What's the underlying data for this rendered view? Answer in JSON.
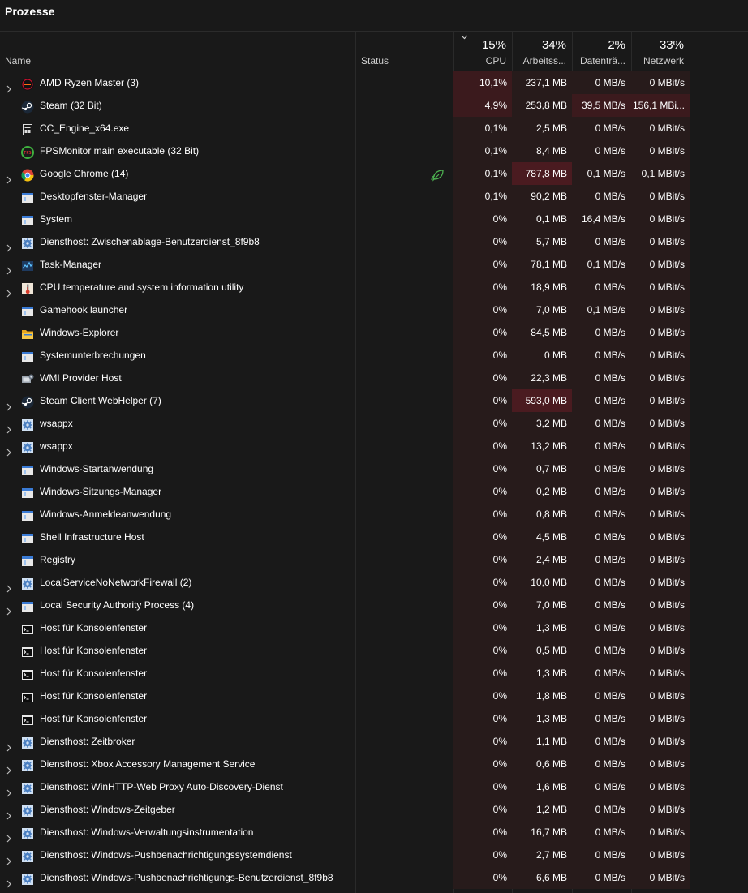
{
  "page": {
    "title": "Prozesse"
  },
  "columns": {
    "name": {
      "label": "Name"
    },
    "status": {
      "label": "Status"
    },
    "cpu": {
      "label": "CPU",
      "total": "15%"
    },
    "memory": {
      "label": "Arbeitss...",
      "total": "34%"
    },
    "disk": {
      "label": "Datenträ...",
      "total": "2%"
    },
    "network": {
      "label": "Netzwerk",
      "total": "33%"
    }
  },
  "colors": {
    "background": "#191919",
    "heat_low": "#271b1b",
    "heat_mid": "#3b1a1d",
    "heat_high": "#4a1b20",
    "eco_leaf": "#4caf50"
  },
  "processes": [
    {
      "name": "AMD Ryzen Master (3)",
      "icon": "amd-ryzen-icon",
      "expandable": true,
      "eco": false,
      "cpu": "10,1%",
      "mem": "237,1 MB",
      "disk": "0 MB/s",
      "net": "0 MBit/s",
      "heat": [
        2,
        1,
        1,
        1
      ]
    },
    {
      "name": "Steam (32 Bit)",
      "icon": "steam-icon",
      "expandable": false,
      "eco": false,
      "cpu": "4,9%",
      "mem": "253,8 MB",
      "disk": "39,5 MB/s",
      "net": "156,1 MBi...",
      "heat": [
        2,
        1,
        2,
        2
      ]
    },
    {
      "name": "CC_Engine_x64.exe",
      "icon": "app-generic-icon",
      "expandable": false,
      "eco": false,
      "cpu": "0,1%",
      "mem": "2,5 MB",
      "disk": "0 MB/s",
      "net": "0 MBit/s",
      "heat": [
        1,
        1,
        1,
        1
      ]
    },
    {
      "name": "FPSMonitor main executable (32 Bit)",
      "icon": "fpsmonitor-icon",
      "expandable": false,
      "eco": false,
      "cpu": "0,1%",
      "mem": "8,4 MB",
      "disk": "0 MB/s",
      "net": "0 MBit/s",
      "heat": [
        1,
        1,
        1,
        1
      ]
    },
    {
      "name": "Google Chrome (14)",
      "icon": "chrome-icon",
      "expandable": true,
      "eco": true,
      "cpu": "0,1%",
      "mem": "787,8 MB",
      "disk": "0,1 MB/s",
      "net": "0,1 MBit/s",
      "heat": [
        1,
        3,
        1,
        1
      ]
    },
    {
      "name": "Desktopfenster-Manager",
      "icon": "window-icon",
      "expandable": false,
      "eco": false,
      "cpu": "0,1%",
      "mem": "90,2 MB",
      "disk": "0 MB/s",
      "net": "0 MBit/s",
      "heat": [
        1,
        1,
        1,
        1
      ]
    },
    {
      "name": "System",
      "icon": "window-icon",
      "expandable": false,
      "eco": false,
      "cpu": "0%",
      "mem": "0,1 MB",
      "disk": "16,4 MB/s",
      "net": "0 MBit/s",
      "heat": [
        1,
        1,
        1,
        1
      ]
    },
    {
      "name": "Diensthost: Zwischenablage-Benutzerdienst_8f9b8",
      "icon": "gear-icon",
      "expandable": true,
      "eco": false,
      "cpu": "0%",
      "mem": "5,7 MB",
      "disk": "0 MB/s",
      "net": "0 MBit/s",
      "heat": [
        1,
        1,
        1,
        1
      ]
    },
    {
      "name": "Task-Manager",
      "icon": "taskmanager-icon",
      "expandable": true,
      "eco": false,
      "cpu": "0%",
      "mem": "78,1 MB",
      "disk": "0,1 MB/s",
      "net": "0 MBit/s",
      "heat": [
        1,
        1,
        1,
        1
      ]
    },
    {
      "name": "CPU temperature and system information utility",
      "icon": "thermometer-icon",
      "expandable": true,
      "eco": false,
      "cpu": "0%",
      "mem": "18,9 MB",
      "disk": "0 MB/s",
      "net": "0 MBit/s",
      "heat": [
        1,
        1,
        1,
        1
      ]
    },
    {
      "name": "Gamehook launcher",
      "icon": "window-icon",
      "expandable": false,
      "eco": false,
      "cpu": "0%",
      "mem": "7,0 MB",
      "disk": "0,1 MB/s",
      "net": "0 MBit/s",
      "heat": [
        1,
        1,
        1,
        1
      ]
    },
    {
      "name": "Windows-Explorer",
      "icon": "folder-icon",
      "expandable": false,
      "eco": false,
      "cpu": "0%",
      "mem": "84,5 MB",
      "disk": "0 MB/s",
      "net": "0 MBit/s",
      "heat": [
        1,
        1,
        1,
        1
      ]
    },
    {
      "name": "Systemunterbrechungen",
      "icon": "window-icon",
      "expandable": false,
      "eco": false,
      "cpu": "0%",
      "mem": "0 MB",
      "disk": "0 MB/s",
      "net": "0 MBit/s",
      "heat": [
        1,
        1,
        1,
        1
      ]
    },
    {
      "name": "WMI Provider Host",
      "icon": "wmi-icon",
      "expandable": false,
      "eco": false,
      "cpu": "0%",
      "mem": "22,3 MB",
      "disk": "0 MB/s",
      "net": "0 MBit/s",
      "heat": [
        1,
        1,
        1,
        1
      ]
    },
    {
      "name": "Steam Client WebHelper (7)",
      "icon": "steam-icon",
      "expandable": true,
      "eco": false,
      "cpu": "0%",
      "mem": "593,0 MB",
      "disk": "0 MB/s",
      "net": "0 MBit/s",
      "heat": [
        1,
        3,
        1,
        1
      ]
    },
    {
      "name": "wsappx",
      "icon": "gear-icon",
      "expandable": true,
      "eco": false,
      "cpu": "0%",
      "mem": "3,2 MB",
      "disk": "0 MB/s",
      "net": "0 MBit/s",
      "heat": [
        1,
        1,
        1,
        1
      ]
    },
    {
      "name": "wsappx",
      "icon": "gear-icon",
      "expandable": true,
      "eco": false,
      "cpu": "0%",
      "mem": "13,2 MB",
      "disk": "0 MB/s",
      "net": "0 MBit/s",
      "heat": [
        1,
        1,
        1,
        1
      ]
    },
    {
      "name": "Windows-Startanwendung",
      "icon": "window-icon",
      "expandable": false,
      "eco": false,
      "cpu": "0%",
      "mem": "0,7 MB",
      "disk": "0 MB/s",
      "net": "0 MBit/s",
      "heat": [
        1,
        1,
        1,
        1
      ]
    },
    {
      "name": "Windows-Sitzungs-Manager",
      "icon": "window-icon",
      "expandable": false,
      "eco": false,
      "cpu": "0%",
      "mem": "0,2 MB",
      "disk": "0 MB/s",
      "net": "0 MBit/s",
      "heat": [
        1,
        1,
        1,
        1
      ]
    },
    {
      "name": "Windows-Anmeldeanwendung",
      "icon": "window-icon",
      "expandable": false,
      "eco": false,
      "cpu": "0%",
      "mem": "0,8 MB",
      "disk": "0 MB/s",
      "net": "0 MBit/s",
      "heat": [
        1,
        1,
        1,
        1
      ]
    },
    {
      "name": "Shell Infrastructure Host",
      "icon": "window-icon",
      "expandable": false,
      "eco": false,
      "cpu": "0%",
      "mem": "4,5 MB",
      "disk": "0 MB/s",
      "net": "0 MBit/s",
      "heat": [
        1,
        1,
        1,
        1
      ]
    },
    {
      "name": "Registry",
      "icon": "window-icon",
      "expandable": false,
      "eco": false,
      "cpu": "0%",
      "mem": "2,4 MB",
      "disk": "0 MB/s",
      "net": "0 MBit/s",
      "heat": [
        1,
        1,
        1,
        1
      ]
    },
    {
      "name": "LocalServiceNoNetworkFirewall (2)",
      "icon": "gear-icon",
      "expandable": true,
      "eco": false,
      "cpu": "0%",
      "mem": "10,0 MB",
      "disk": "0 MB/s",
      "net": "0 MBit/s",
      "heat": [
        1,
        1,
        1,
        1
      ]
    },
    {
      "name": "Local Security Authority Process (4)",
      "icon": "window-icon",
      "expandable": true,
      "eco": false,
      "cpu": "0%",
      "mem": "7,0 MB",
      "disk": "0 MB/s",
      "net": "0 MBit/s",
      "heat": [
        1,
        1,
        1,
        1
      ]
    },
    {
      "name": "Host für Konsolenfenster",
      "icon": "console-icon",
      "expandable": false,
      "eco": false,
      "cpu": "0%",
      "mem": "1,3 MB",
      "disk": "0 MB/s",
      "net": "0 MBit/s",
      "heat": [
        1,
        1,
        1,
        1
      ]
    },
    {
      "name": "Host für Konsolenfenster",
      "icon": "console-icon",
      "expandable": false,
      "eco": false,
      "cpu": "0%",
      "mem": "0,5 MB",
      "disk": "0 MB/s",
      "net": "0 MBit/s",
      "heat": [
        1,
        1,
        1,
        1
      ]
    },
    {
      "name": "Host für Konsolenfenster",
      "icon": "console-icon",
      "expandable": false,
      "eco": false,
      "cpu": "0%",
      "mem": "1,3 MB",
      "disk": "0 MB/s",
      "net": "0 MBit/s",
      "heat": [
        1,
        1,
        1,
        1
      ]
    },
    {
      "name": "Host für Konsolenfenster",
      "icon": "console-icon",
      "expandable": false,
      "eco": false,
      "cpu": "0%",
      "mem": "1,8 MB",
      "disk": "0 MB/s",
      "net": "0 MBit/s",
      "heat": [
        1,
        1,
        1,
        1
      ]
    },
    {
      "name": "Host für Konsolenfenster",
      "icon": "console-icon",
      "expandable": false,
      "eco": false,
      "cpu": "0%",
      "mem": "1,3 MB",
      "disk": "0 MB/s",
      "net": "0 MBit/s",
      "heat": [
        1,
        1,
        1,
        1
      ]
    },
    {
      "name": "Diensthost: Zeitbroker",
      "icon": "gear-icon",
      "expandable": true,
      "eco": false,
      "cpu": "0%",
      "mem": "1,1 MB",
      "disk": "0 MB/s",
      "net": "0 MBit/s",
      "heat": [
        1,
        1,
        1,
        1
      ]
    },
    {
      "name": "Diensthost: Xbox Accessory Management Service",
      "icon": "gear-icon",
      "expandable": true,
      "eco": false,
      "cpu": "0%",
      "mem": "0,6 MB",
      "disk": "0 MB/s",
      "net": "0 MBit/s",
      "heat": [
        1,
        1,
        1,
        1
      ]
    },
    {
      "name": "Diensthost: WinHTTP-Web Proxy Auto-Discovery-Dienst",
      "icon": "gear-icon",
      "expandable": true,
      "eco": false,
      "cpu": "0%",
      "mem": "1,6 MB",
      "disk": "0 MB/s",
      "net": "0 MBit/s",
      "heat": [
        1,
        1,
        1,
        1
      ]
    },
    {
      "name": "Diensthost: Windows-Zeitgeber",
      "icon": "gear-icon",
      "expandable": true,
      "eco": false,
      "cpu": "0%",
      "mem": "1,2 MB",
      "disk": "0 MB/s",
      "net": "0 MBit/s",
      "heat": [
        1,
        1,
        1,
        1
      ]
    },
    {
      "name": "Diensthost: Windows-Verwaltungsinstrumentation",
      "icon": "gear-icon",
      "expandable": true,
      "eco": false,
      "cpu": "0%",
      "mem": "16,7 MB",
      "disk": "0 MB/s",
      "net": "0 MBit/s",
      "heat": [
        1,
        1,
        1,
        1
      ]
    },
    {
      "name": "Diensthost: Windows-Pushbenachrichtigungssystemdienst",
      "icon": "gear-icon",
      "expandable": true,
      "eco": false,
      "cpu": "0%",
      "mem": "2,7 MB",
      "disk": "0 MB/s",
      "net": "0 MBit/s",
      "heat": [
        1,
        1,
        1,
        1
      ]
    },
    {
      "name": "Diensthost: Windows-Pushbenachrichtigungs-Benutzerdienst_8f9b8",
      "icon": "gear-icon",
      "expandable": true,
      "eco": false,
      "cpu": "0%",
      "mem": "6,6 MB",
      "disk": "0 MB/s",
      "net": "0 MBit/s",
      "heat": [
        1,
        1,
        1,
        1
      ]
    }
  ]
}
